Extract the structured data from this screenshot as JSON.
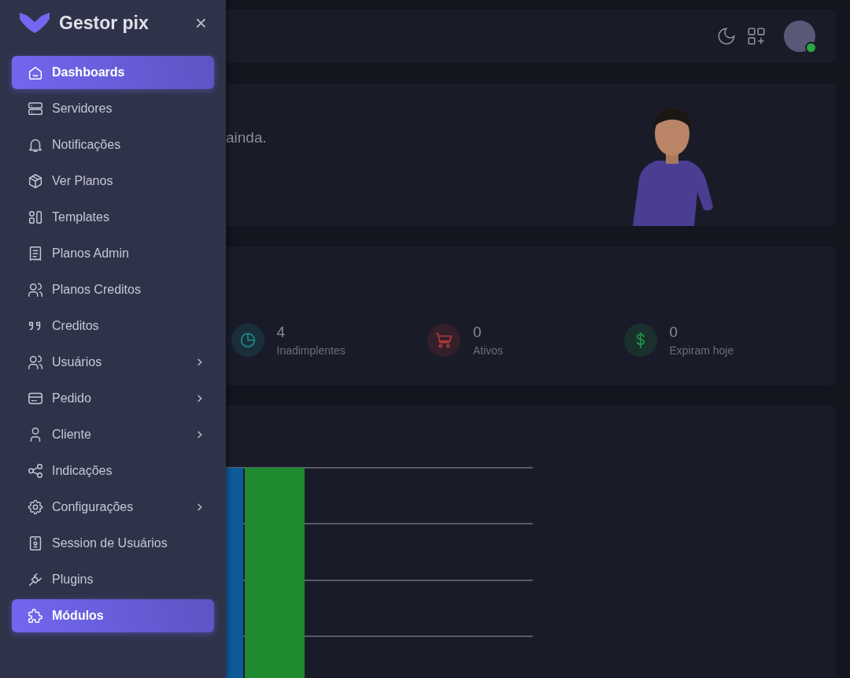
{
  "sidebar": {
    "brand": "Gestor pix",
    "close": "×",
    "items": [
      {
        "label": "Dashboards",
        "selected": true,
        "submenu": false
      },
      {
        "label": "Servidores",
        "selected": false,
        "submenu": false
      },
      {
        "label": "Notificações",
        "selected": false,
        "submenu": false
      },
      {
        "label": "Ver Planos",
        "selected": false,
        "submenu": false
      },
      {
        "label": "Templates",
        "selected": false,
        "submenu": false
      },
      {
        "label": "Planos Admin",
        "selected": false,
        "submenu": false
      },
      {
        "label": "Planos Creditos",
        "selected": false,
        "submenu": false
      },
      {
        "label": "Creditos",
        "selected": false,
        "submenu": false
      },
      {
        "label": "Usuários",
        "selected": false,
        "submenu": true
      },
      {
        "label": "Pedido",
        "selected": false,
        "submenu": true
      },
      {
        "label": "Cliente",
        "selected": false,
        "submenu": true
      },
      {
        "label": "Indicações",
        "selected": false,
        "submenu": false
      },
      {
        "label": "Configurações",
        "selected": false,
        "submenu": true
      },
      {
        "label": "Session de Usuários",
        "selected": false,
        "submenu": false
      },
      {
        "label": "Plugins",
        "selected": false,
        "submenu": false
      },
      {
        "label": "Módulos",
        "selected": true,
        "submenu": false
      }
    ]
  },
  "navbar": {
    "avatar_online": true
  },
  "welcome": {
    "text": "ainda."
  },
  "stats": [
    {
      "value": "4",
      "label": "Inadimplentes",
      "color": "#1f8a8c"
    },
    {
      "value": "0",
      "label": "Ativos",
      "color": "#b2383a"
    },
    {
      "value": "0",
      "label": "Expiram hoje",
      "color": "#22914a"
    }
  ]
}
